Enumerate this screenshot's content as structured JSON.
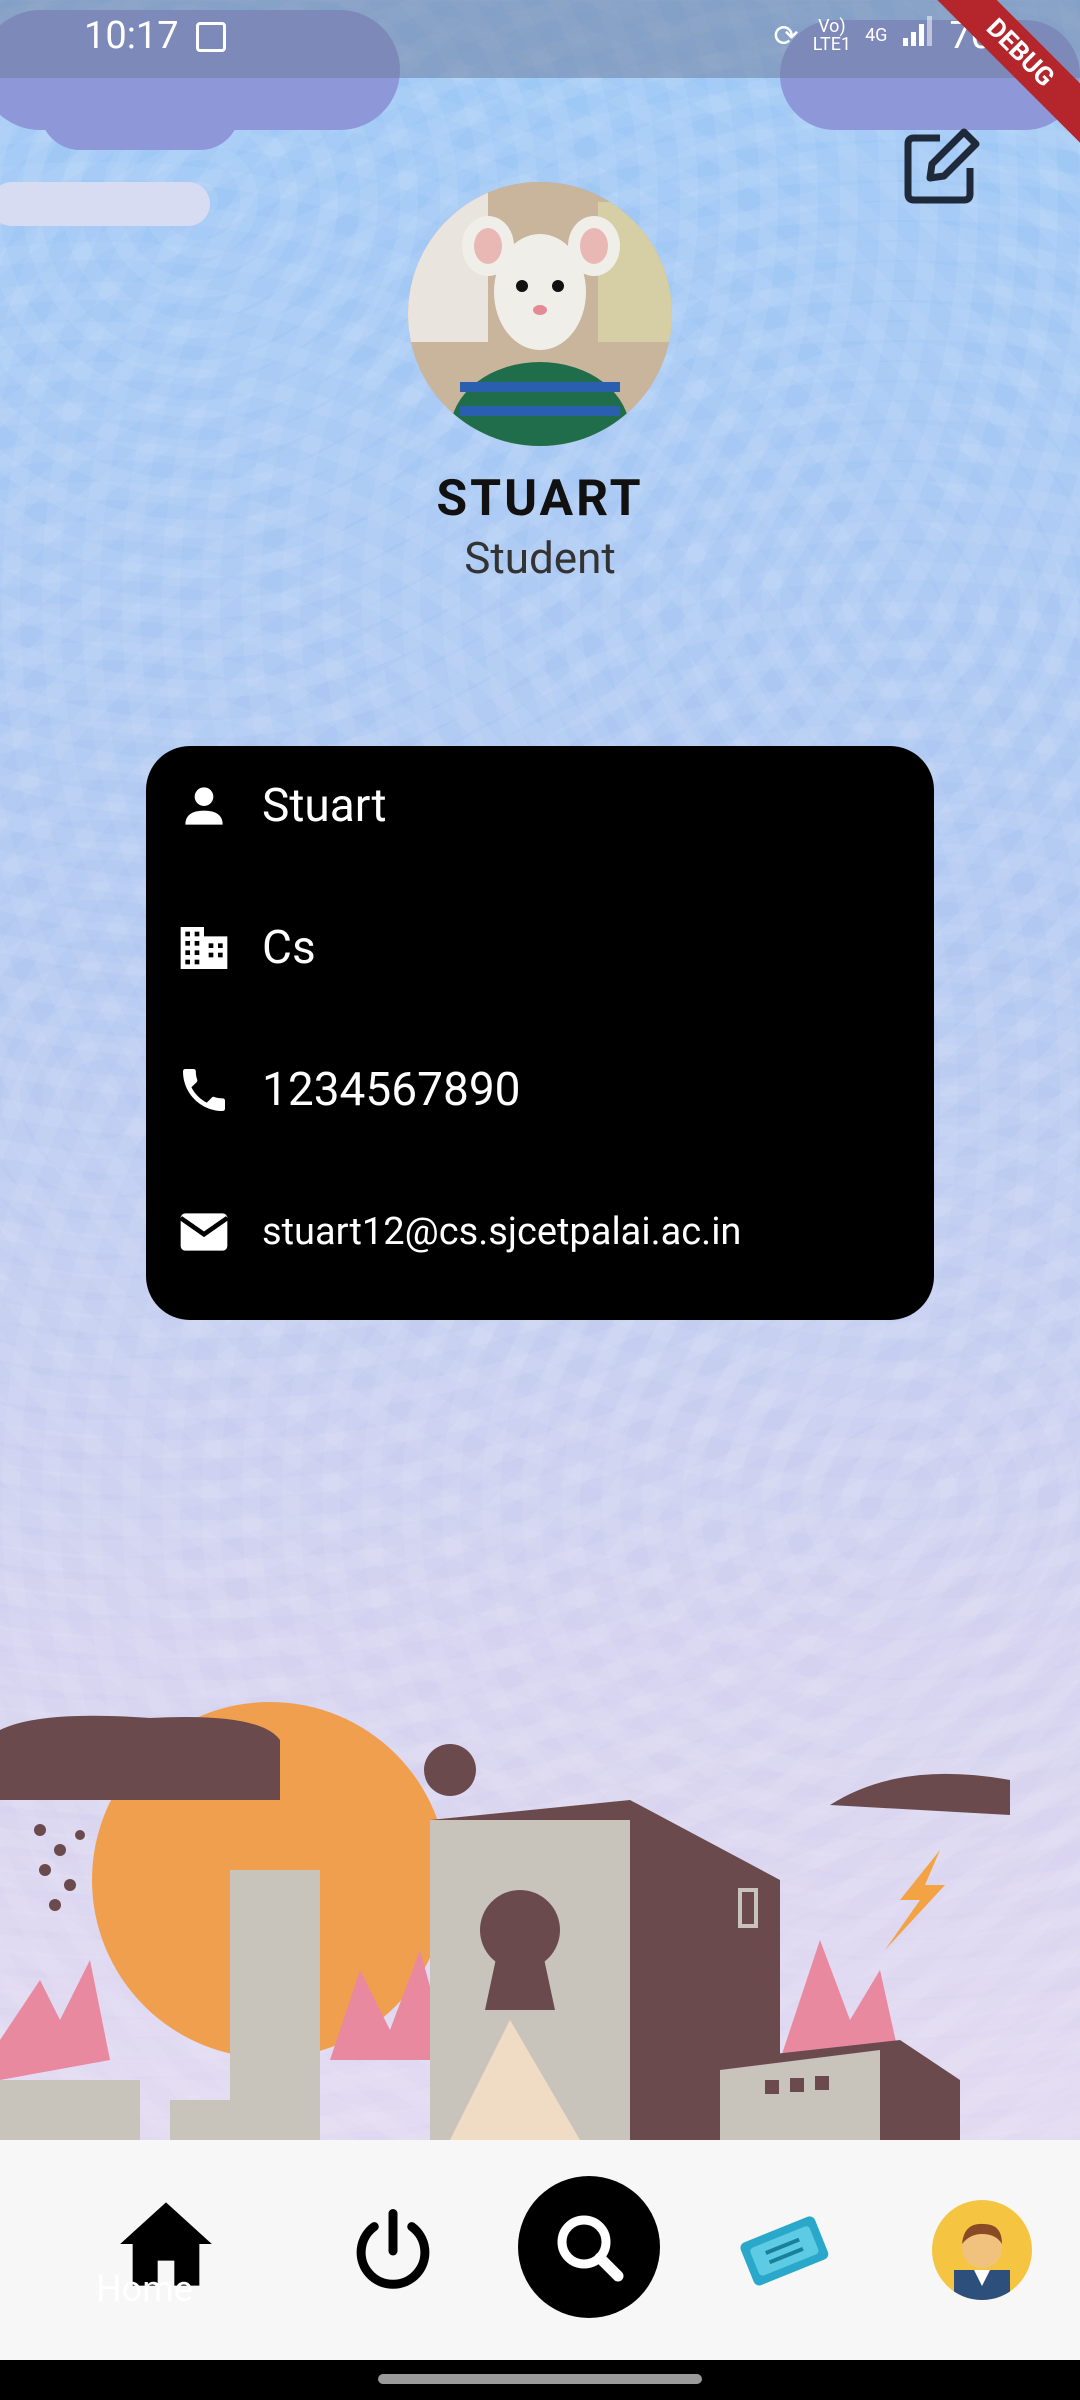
{
  "status_bar": {
    "time": "10:17",
    "network_top": "Vo)",
    "network_bottom": "LTE1",
    "signal_type": "4G",
    "battery": "70%"
  },
  "debug_ribbon": "DEBUG",
  "profile": {
    "name": "STUART",
    "role": "Student"
  },
  "info": {
    "full_name": "Stuart",
    "department": "Cs",
    "phone": "1234567890",
    "email": "stuart12@cs.sjcetpalai.ac.in"
  },
  "nav": {
    "home_label": "Home"
  },
  "icons": [
    "image-icon",
    "edit-icon",
    "person-icon",
    "building-icon",
    "phone-icon",
    "email-icon",
    "home-icon",
    "power-icon",
    "search-icon",
    "ticket-icon",
    "avatar"
  ]
}
